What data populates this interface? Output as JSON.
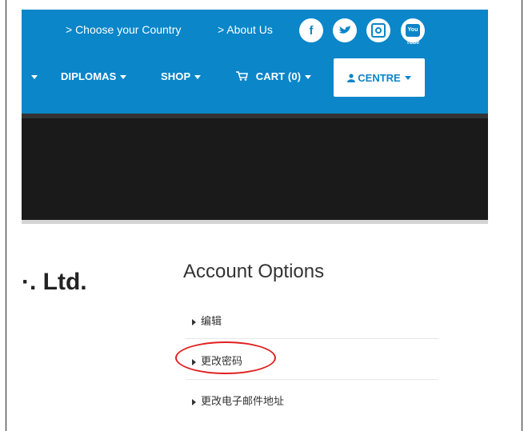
{
  "topbar": {
    "links": [
      "> Choose your Country",
      "> About Us"
    ],
    "social": [
      {
        "name": "facebook-icon",
        "glyph": "f"
      },
      {
        "name": "twitter-icon",
        "glyph": "❧"
      },
      {
        "name": "instagram-icon",
        "glyph": ""
      },
      {
        "name": "youtube-icon",
        "glyph": "You Tube"
      }
    ]
  },
  "nav": {
    "items": [
      "DIPLOMAS",
      "SHOP",
      "CART (0)"
    ],
    "centre_label": "CENTRE"
  },
  "company_name": "·. Ltd.",
  "account": {
    "title": "Account Options",
    "options": [
      "编辑",
      "更改密码",
      "更改电子邮件地址"
    ]
  },
  "colors": {
    "brand_blue": "#0a86c9",
    "highlight": "#e0201f"
  }
}
